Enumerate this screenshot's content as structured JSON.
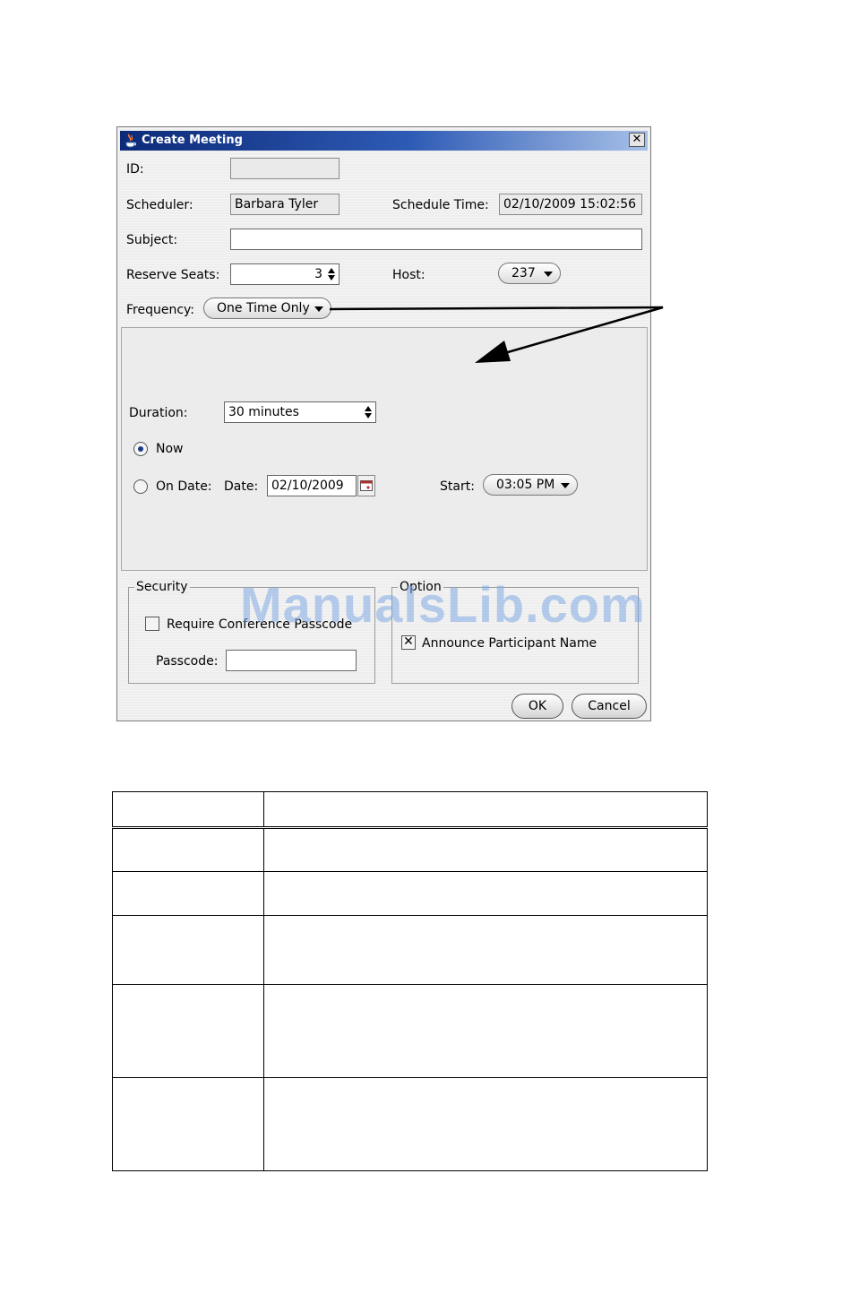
{
  "dialog": {
    "title": "Create Meeting",
    "close_glyph": "✕",
    "labels": {
      "id": "ID:",
      "scheduler": "Scheduler:",
      "schedule_time": "Schedule Time:",
      "subject": "Subject:",
      "reserve_seats": "Reserve Seats:",
      "host": "Host:",
      "frequency": "Frequency:",
      "duration": "Duration:",
      "now": "Now",
      "on_date": "On Date:",
      "date": "Date:",
      "start": "Start:"
    },
    "values": {
      "id": "",
      "scheduler": "Barbara Tyler",
      "schedule_time": "02/10/2009 15:02:56",
      "subject": "",
      "reserve_seats": "3",
      "host": "237",
      "frequency": "One Time Only",
      "duration": "30 minutes",
      "date": "02/10/2009",
      "start": "03:05 PM"
    },
    "schedule_mode": "now",
    "security": {
      "legend": "Security",
      "require_passcode_label": "Require Conference Passcode",
      "require_passcode_checked": false,
      "passcode_label": "Passcode:",
      "passcode_value": ""
    },
    "option": {
      "legend": "Option",
      "announce_label": "Announce Participant Name",
      "announce_checked": true
    },
    "buttons": {
      "ok": "OK",
      "cancel": "Cancel"
    }
  },
  "watermark": "ManualsLib.com",
  "colors": {
    "title_bar_start": "#0c2a78",
    "title_bar_end": "#a7c0e8",
    "dialog_bg": "#eeeeee",
    "watermark": "#82aae6"
  }
}
